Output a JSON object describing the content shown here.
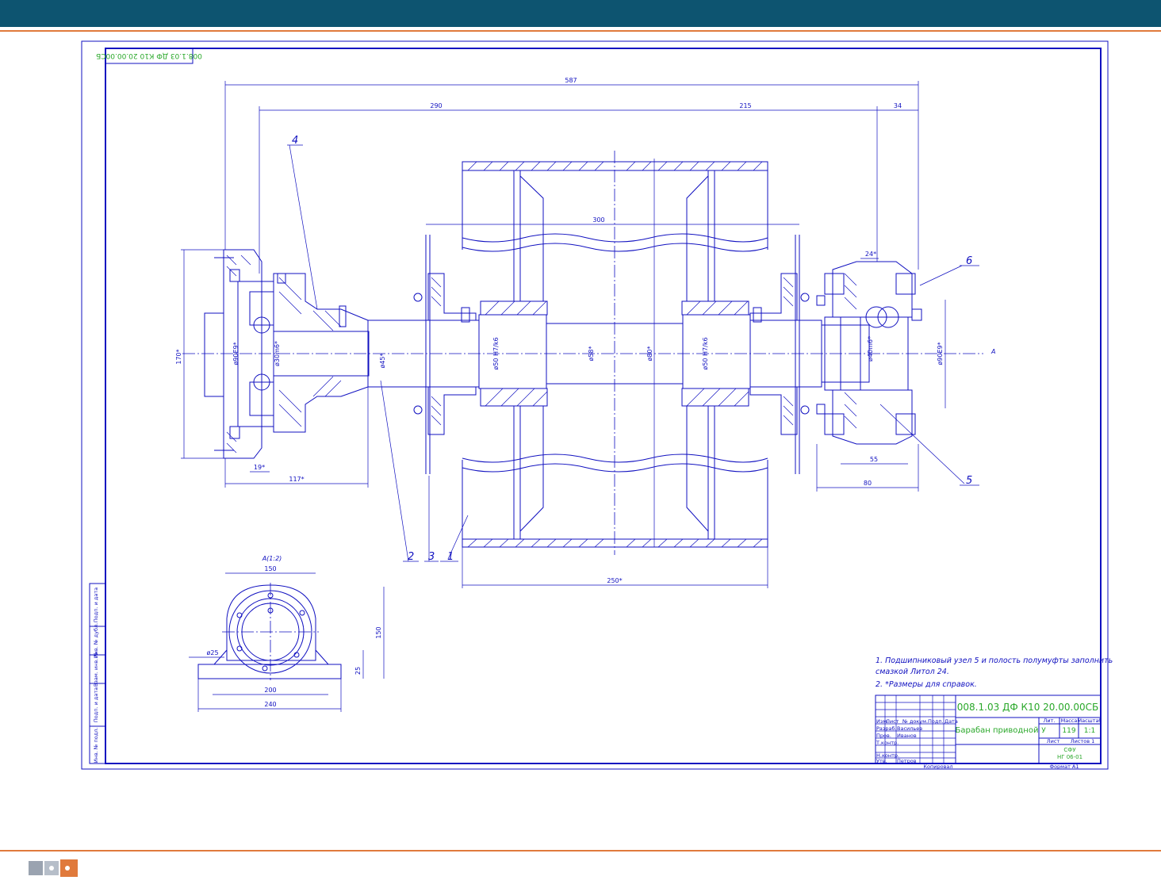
{
  "header": {
    "bar_color": "#0d5470",
    "accent_color": "#e07a3c"
  },
  "drawing": {
    "inverted_stamp": "008.1.03 ДФ К10 20.00.00СБ",
    "dims": {
      "overall": "587",
      "left_span": "290",
      "right_span": "215",
      "right_end": "34",
      "drum_inner": "300",
      "drum_len": "250*",
      "left_height": "170*",
      "left_width": "117*",
      "left_small": "19*",
      "right_24": "24*",
      "right_55": "55",
      "right_80": "80",
      "right_dia": "ø90E9*",
      "left_dia": "ø90E9*",
      "left_shaft": "ø30m6*",
      "shaft_45": "ø45*",
      "shaft_50": "ø50 H7/k6",
      "shaft_58": "ø58*",
      "drum_dia": "ø80*",
      "shaft_50b": "ø50 H7/k6",
      "right_shaft": "ø40m6*",
      "view_mark": "A"
    },
    "positions": [
      "1",
      "2",
      "3",
      "4",
      "5",
      "6"
    ],
    "view": {
      "title": "А(1:2)",
      "w150": "150",
      "h150": "150",
      "h25": "25",
      "d25": "ø25",
      "w200": "200",
      "w240": "240"
    },
    "notes": [
      "1. Подшипниковый узел 5 и полость полумуфты заполнить",
      "смазкой Литол 24.",
      "2. *Размеры для справок."
    ],
    "side_strip": [
      "Инв. № подл.",
      "Подп. и дата",
      "Взам. инв. №",
      "Инв. № дубл.",
      "Подп. и дата"
    ],
    "title_block": {
      "designation": "008.1.03 ДФ К10 20.00.00СБ",
      "name": "Барабан приводной",
      "col_lit": "Лит.",
      "col_mass": "Масса",
      "col_scale": "Масштаб",
      "lit_value": "У",
      "mass_value": "119",
      "scale_value": "1:1",
      "sheet_label": "Лист",
      "sheets_label": "Листов 1",
      "org_line1": "СФУ",
      "org_line2": "НГ 06-01",
      "rows": [
        {
          "role": "Изм.",
          "doc": "Лист",
          "name": "№ докум.",
          "sign": "Подп.",
          "date": "Дата"
        },
        {
          "role": "Разраб.",
          "name": "Васильев"
        },
        {
          "role": "Пров.",
          "name": "Иванов"
        },
        {
          "role": "Т.контр."
        },
        {
          "role": "Н.контр."
        },
        {
          "role": "Утв.",
          "name": "Петров"
        }
      ],
      "copied": "Копировал",
      "format": "Формат А1"
    }
  }
}
